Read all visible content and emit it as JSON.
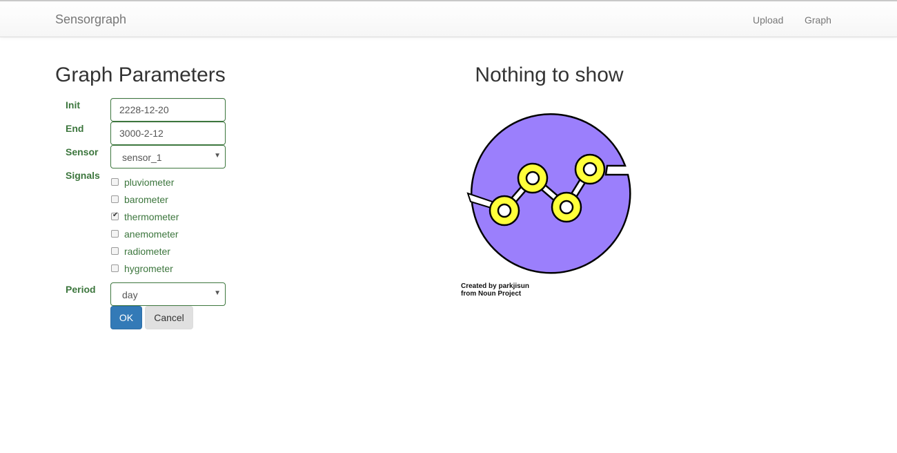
{
  "navbar": {
    "brand": "Sensorgraph",
    "links": [
      {
        "label": "Upload"
      },
      {
        "label": "Graph"
      }
    ]
  },
  "form": {
    "title": "Graph Parameters",
    "init": {
      "label": "Init",
      "value": "2228-12-20"
    },
    "end": {
      "label": "End",
      "value": "3000-2-12"
    },
    "sensor": {
      "label": "Sensor",
      "selected": "sensor_1"
    },
    "signals": {
      "label": "Signals",
      "options": [
        {
          "label": "pluviometer",
          "checked": false
        },
        {
          "label": "barometer",
          "checked": false
        },
        {
          "label": "thermometer",
          "checked": true
        },
        {
          "label": "anemometer",
          "checked": false
        },
        {
          "label": "radiometer",
          "checked": false
        },
        {
          "label": "hygrometer",
          "checked": false
        }
      ]
    },
    "period": {
      "label": "Period",
      "selected": "day"
    },
    "ok_label": "OK",
    "cancel_label": "Cancel"
  },
  "graph": {
    "title": "Nothing to show",
    "icon": "graph-line-icon",
    "credit_line1": "Created by parkjisun",
    "credit_line2": "from Noun Project",
    "colors": {
      "circle": "#9b7ffc",
      "node": "#ffff3a",
      "outline": "#000000"
    }
  }
}
